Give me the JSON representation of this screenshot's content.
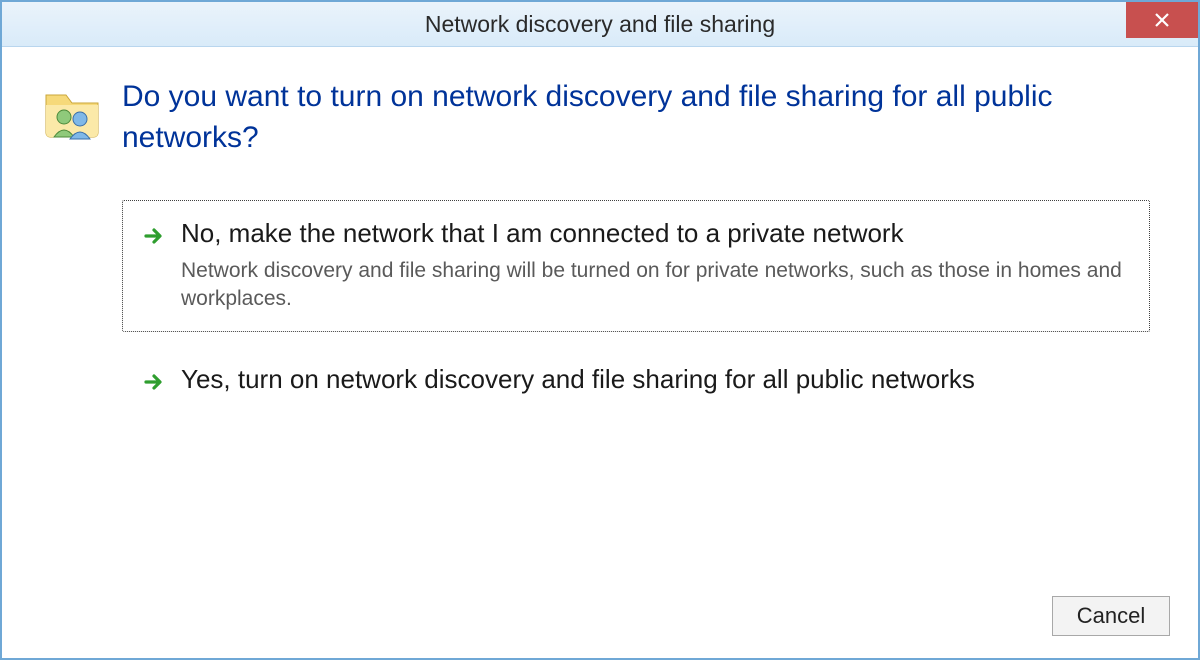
{
  "window": {
    "title": "Network discovery and file sharing"
  },
  "main_instruction": "Do you want to turn on network discovery and file sharing for all public networks?",
  "options": [
    {
      "title": "No, make the network that I am connected to a private network",
      "subtitle": "Network discovery and file sharing will be turned on for private networks, such as those in homes and workplaces.",
      "focused": true
    },
    {
      "title": "Yes, turn on network discovery and file sharing for all public networks",
      "subtitle": "",
      "focused": false
    }
  ],
  "buttons": {
    "cancel": "Cancel"
  },
  "icons": {
    "close": "close-icon",
    "header": "users-folder-icon",
    "arrow": "arrow-right-icon"
  }
}
